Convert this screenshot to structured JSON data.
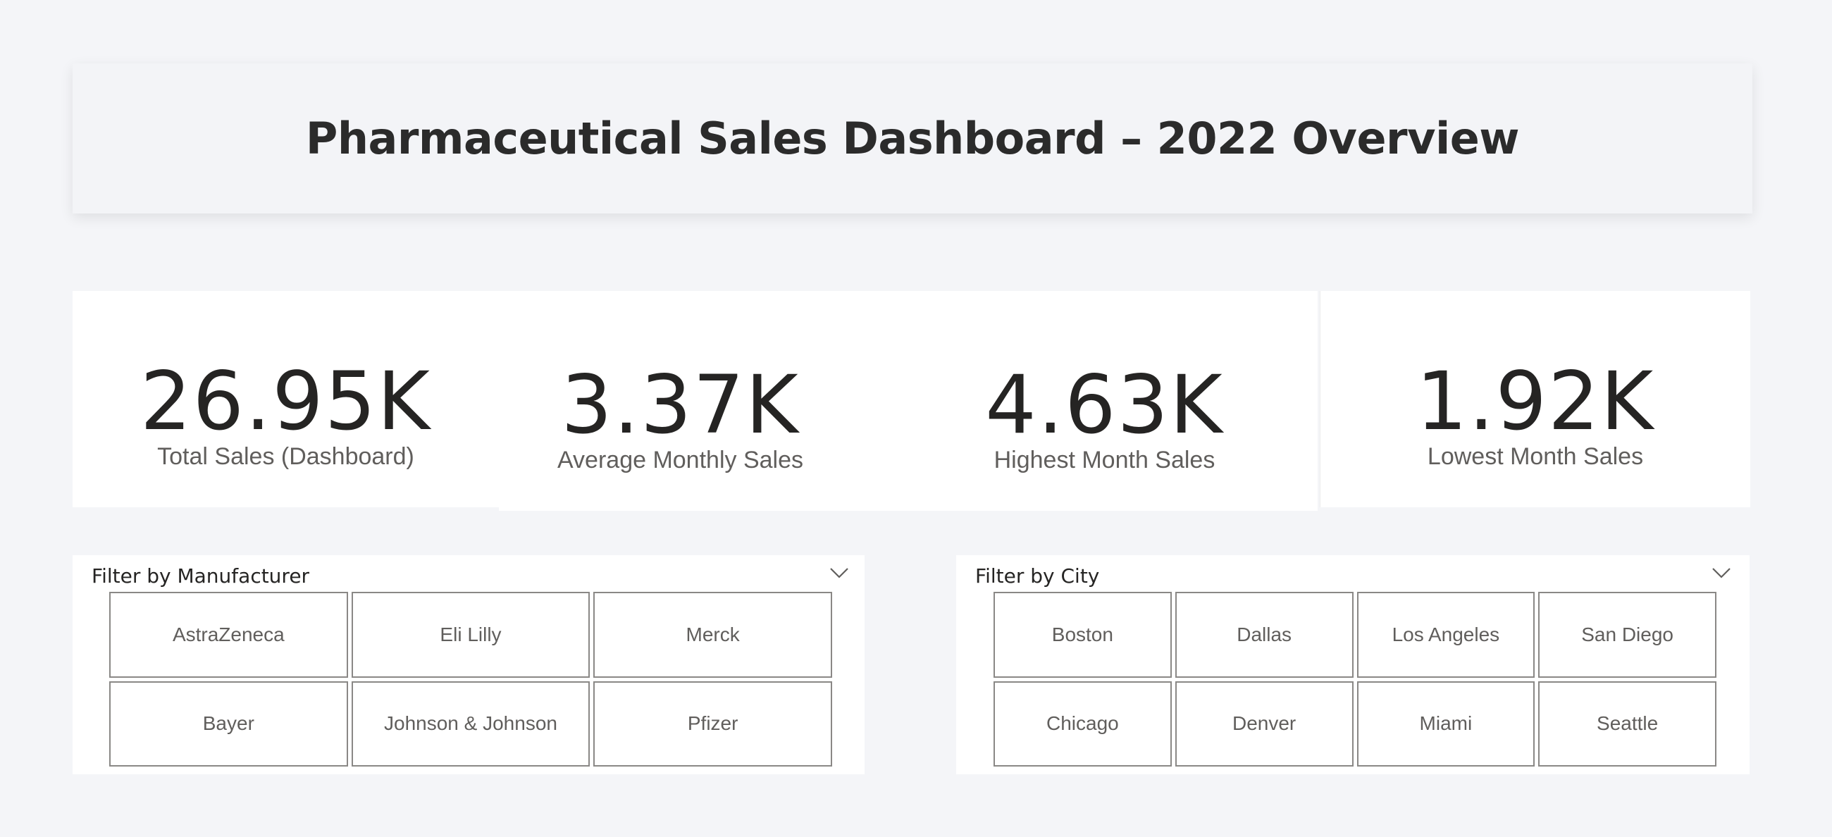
{
  "header": {
    "title": "Pharmaceutical Sales Dashboard – 2022 Overview"
  },
  "kpis": [
    {
      "value": "26.95K",
      "label": "Total Sales (Dashboard)"
    },
    {
      "value": "3.37K",
      "label": "Average Monthly Sales"
    },
    {
      "value": "4.63K",
      "label": "Highest Month Sales"
    },
    {
      "value": "1.92K",
      "label": "Lowest Month Sales"
    }
  ],
  "filters": {
    "manufacturer": {
      "title": "Filter by Manufacturer",
      "items": [
        "AstraZeneca",
        "Eli Lilly",
        "Merck",
        "Bayer",
        "Johnson & Johnson",
        "Pfizer"
      ]
    },
    "city": {
      "title": "Filter by City",
      "items": [
        "Boston",
        "Dallas",
        "Los Angeles",
        "San Diego",
        "Chicago",
        "Denver",
        "Miami",
        "Seattle"
      ]
    }
  },
  "colors": {
    "background": "#f4f5f8",
    "card": "#ffffff",
    "text_primary": "#252423",
    "text_secondary": "#605e5c",
    "tile_border": "#8a8886"
  },
  "icons": {
    "dropdown": "chevron-down-icon"
  }
}
